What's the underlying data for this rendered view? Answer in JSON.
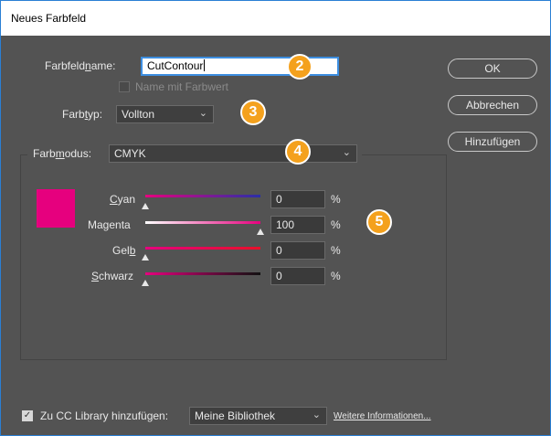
{
  "window": {
    "title": "Neues Farbfeld"
  },
  "swatch_name": {
    "label": "Farbfeldname:",
    "value": "CutContour",
    "name_with_value_label": "Name mit Farbwert"
  },
  "color_type": {
    "label": "Farbtyp:",
    "value": "Vollton"
  },
  "color_mode": {
    "label": "Farbmodus:",
    "value": "CMYK"
  },
  "sliders": [
    {
      "label": "Cyan",
      "value": "0",
      "unit": "%",
      "level": 0
    },
    {
      "label": "Magenta",
      "value": "100",
      "unit": "%",
      "level": 100
    },
    {
      "label": "Gelb",
      "value": "0",
      "unit": "%",
      "level": 0
    },
    {
      "label": "Schwarz",
      "value": "0",
      "unit": "%",
      "level": 0
    }
  ],
  "buttons": {
    "ok": "OK",
    "cancel": "Abbrechen",
    "add": "Hinzufügen"
  },
  "library": {
    "label": "Zu CC Library hinzufügen:",
    "checked": true,
    "value": "Meine Bibliothek",
    "more_link": "Weitere Informationen..."
  },
  "badges": [
    "2",
    "3",
    "4",
    "5"
  ],
  "colors": {
    "swatch": "#e6007e",
    "badge": "#f4a11d",
    "background": "#535353"
  }
}
